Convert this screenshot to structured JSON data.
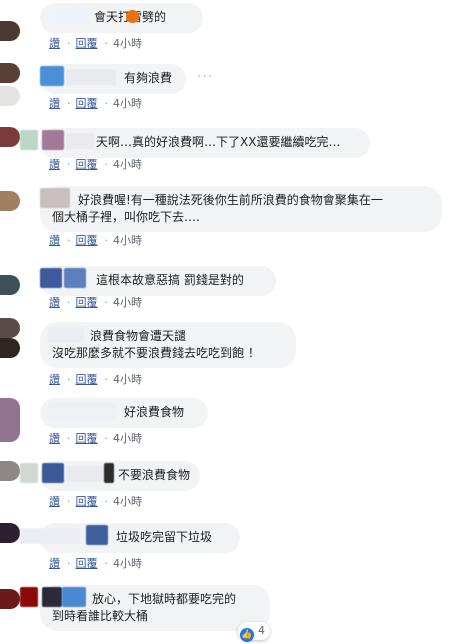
{
  "actions": {
    "read": "讚",
    "reply": "回覆",
    "time": "4小時",
    "sep": "·"
  },
  "comments": [
    {
      "text": "會天打雷劈的",
      "emoji": "angry-face"
    },
    {
      "text": "有夠浪費",
      "more": "···"
    },
    {
      "text": "天啊…真的好浪費啊…下了XX還要繼續吃完…"
    },
    {
      "text_line1": "好浪費喔!有一種說法死後你生前所浪費的食物會聚集在一",
      "text_line2": "個大桶子裡，叫你吃下去…."
    },
    {
      "text": "這根本故意惡搞 罰錢是對的"
    },
    {
      "text_line1": "浪費食物會遭天譴",
      "text_line2": "沒吃那麼多就不要浪費錢去吃吃到飽 ！"
    },
    {
      "text": "好浪費食物"
    },
    {
      "text": "不要浪費食物"
    },
    {
      "text": "垃圾吃完留下垃圾"
    },
    {
      "text_line1": "放心，下地獄時都要吃完的",
      "text_line2": "到時看誰比較大桶",
      "reaction_count": "4",
      "reaction_icon": "like-icon"
    }
  ],
  "colors": {
    "link": "#385898",
    "bubble": "#f2f3f5",
    "meta": "#606770"
  }
}
